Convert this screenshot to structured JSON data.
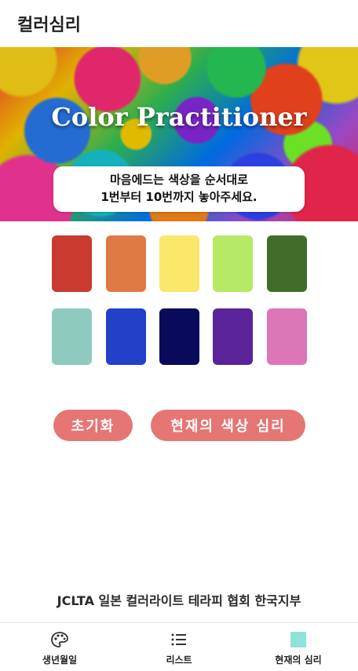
{
  "header": {
    "title": "컬러심리"
  },
  "hero": {
    "title": "Color Practitioner",
    "instruction_line1": "마음에드는 색상을 순서대로",
    "instruction_line2": "1번부터 10번까지 놓아주세요."
  },
  "swatches": [
    {
      "color": "#c93a2f"
    },
    {
      "color": "#e07a45"
    },
    {
      "color": "#fbe76a"
    },
    {
      "color": "#b6e964"
    },
    {
      "color": "#3e6e2a"
    },
    {
      "color": "#8fcabf"
    },
    {
      "color": "#2340c8"
    },
    {
      "color": "#0a0a5c"
    },
    {
      "color": "#5a239a"
    },
    {
      "color": "#dc76b7"
    }
  ],
  "buttons": {
    "reset_label": "초기화",
    "current_psych_label": "현재의 색상 심리",
    "accent_color": "#e67673"
  },
  "footer": {
    "org_text": "JCLTA 일본 컬러라이트 테라피 협회 한국지부"
  },
  "bottom_nav": {
    "items": [
      {
        "label": "생년월일",
        "icon": "palette-icon"
      },
      {
        "label": "리스트",
        "icon": "list-icon"
      },
      {
        "label": "현재의 심리",
        "icon": "square-icon",
        "icon_color": "#8fe3d8"
      }
    ]
  }
}
